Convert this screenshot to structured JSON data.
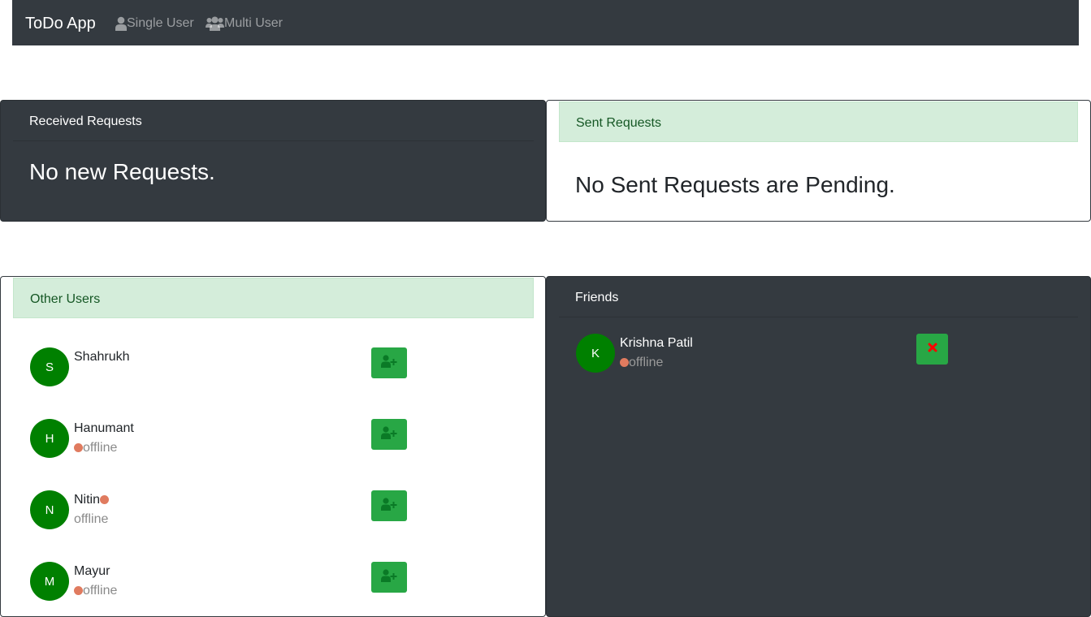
{
  "navbar": {
    "brand": "ToDo App",
    "links": [
      {
        "label": "Single User",
        "icon": "user-icon"
      },
      {
        "label": "Multi User",
        "icon": "users-icon"
      }
    ]
  },
  "received": {
    "header": "Received Requests",
    "message": "No new Requests."
  },
  "sent": {
    "header": "Sent Requests",
    "message": "No Sent Requests are Pending."
  },
  "other_users": {
    "header": "Other Users",
    "users": [
      {
        "initial": "S",
        "name": "Shahrukh",
        "status": ""
      },
      {
        "initial": "H",
        "name": "Hanumant",
        "status": "offline"
      },
      {
        "initial": "N",
        "name": "Nitin",
        "status": "offline"
      },
      {
        "initial": "M",
        "name": "Mayur",
        "status": "offline"
      }
    ]
  },
  "friends": {
    "header": "Friends",
    "users": [
      {
        "initial": "K",
        "name": "Krishna Patil",
        "status": "offline"
      }
    ]
  },
  "colors": {
    "dark": "#343a40",
    "success_bg": "#d4edda",
    "success_text": "#155724",
    "button": "#28a745",
    "avatar": "#008000",
    "offline_dot": "#e07b5f",
    "remove_x": "#ff0000"
  }
}
